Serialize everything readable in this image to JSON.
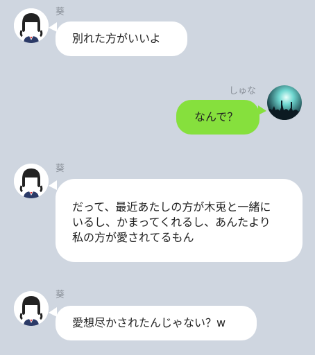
{
  "chat": {
    "messages": [
      {
        "sender": "葵",
        "side": "left",
        "text": "別れた方がいいよ"
      },
      {
        "sender": "しゅな",
        "side": "right",
        "text": "なんで？"
      },
      {
        "sender": "葵",
        "side": "left",
        "lines": [
          "だって、最近あたしの方が木兎と一緒に",
          "いるし、かまってくれるし、あんたより",
          "私の方が愛されてるもん"
        ]
      },
      {
        "sender": "葵",
        "side": "left",
        "text": "愛想尽かされたんじゃない？w"
      }
    ]
  },
  "colors": {
    "background": "#cfd6e0",
    "incoming_bubble": "#ffffff",
    "outgoing_bubble": "#86e03d"
  },
  "icons": {
    "left_avatar": "schoolgirl-avatar-icon",
    "right_avatar": "concert-crowd-avatar-icon"
  }
}
